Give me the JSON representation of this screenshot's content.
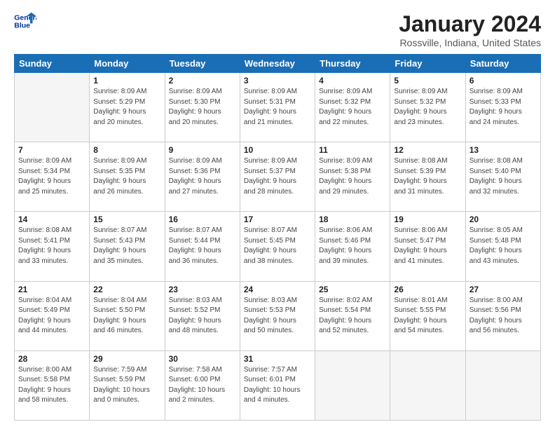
{
  "logo": {
    "line1": "General",
    "line2": "Blue"
  },
  "title": "January 2024",
  "subtitle": "Rossville, Indiana, United States",
  "weekdays": [
    "Sunday",
    "Monday",
    "Tuesday",
    "Wednesday",
    "Thursday",
    "Friday",
    "Saturday"
  ],
  "weeks": [
    [
      {
        "day": "",
        "info": ""
      },
      {
        "day": "1",
        "info": "Sunrise: 8:09 AM\nSunset: 5:29 PM\nDaylight: 9 hours\nand 20 minutes."
      },
      {
        "day": "2",
        "info": "Sunrise: 8:09 AM\nSunset: 5:30 PM\nDaylight: 9 hours\nand 20 minutes."
      },
      {
        "day": "3",
        "info": "Sunrise: 8:09 AM\nSunset: 5:31 PM\nDaylight: 9 hours\nand 21 minutes."
      },
      {
        "day": "4",
        "info": "Sunrise: 8:09 AM\nSunset: 5:32 PM\nDaylight: 9 hours\nand 22 minutes."
      },
      {
        "day": "5",
        "info": "Sunrise: 8:09 AM\nSunset: 5:32 PM\nDaylight: 9 hours\nand 23 minutes."
      },
      {
        "day": "6",
        "info": "Sunrise: 8:09 AM\nSunset: 5:33 PM\nDaylight: 9 hours\nand 24 minutes."
      }
    ],
    [
      {
        "day": "7",
        "info": "Sunrise: 8:09 AM\nSunset: 5:34 PM\nDaylight: 9 hours\nand 25 minutes."
      },
      {
        "day": "8",
        "info": "Sunrise: 8:09 AM\nSunset: 5:35 PM\nDaylight: 9 hours\nand 26 minutes."
      },
      {
        "day": "9",
        "info": "Sunrise: 8:09 AM\nSunset: 5:36 PM\nDaylight: 9 hours\nand 27 minutes."
      },
      {
        "day": "10",
        "info": "Sunrise: 8:09 AM\nSunset: 5:37 PM\nDaylight: 9 hours\nand 28 minutes."
      },
      {
        "day": "11",
        "info": "Sunrise: 8:09 AM\nSunset: 5:38 PM\nDaylight: 9 hours\nand 29 minutes."
      },
      {
        "day": "12",
        "info": "Sunrise: 8:08 AM\nSunset: 5:39 PM\nDaylight: 9 hours\nand 31 minutes."
      },
      {
        "day": "13",
        "info": "Sunrise: 8:08 AM\nSunset: 5:40 PM\nDaylight: 9 hours\nand 32 minutes."
      }
    ],
    [
      {
        "day": "14",
        "info": "Sunrise: 8:08 AM\nSunset: 5:41 PM\nDaylight: 9 hours\nand 33 minutes."
      },
      {
        "day": "15",
        "info": "Sunrise: 8:07 AM\nSunset: 5:43 PM\nDaylight: 9 hours\nand 35 minutes."
      },
      {
        "day": "16",
        "info": "Sunrise: 8:07 AM\nSunset: 5:44 PM\nDaylight: 9 hours\nand 36 minutes."
      },
      {
        "day": "17",
        "info": "Sunrise: 8:07 AM\nSunset: 5:45 PM\nDaylight: 9 hours\nand 38 minutes."
      },
      {
        "day": "18",
        "info": "Sunrise: 8:06 AM\nSunset: 5:46 PM\nDaylight: 9 hours\nand 39 minutes."
      },
      {
        "day": "19",
        "info": "Sunrise: 8:06 AM\nSunset: 5:47 PM\nDaylight: 9 hours\nand 41 minutes."
      },
      {
        "day": "20",
        "info": "Sunrise: 8:05 AM\nSunset: 5:48 PM\nDaylight: 9 hours\nand 43 minutes."
      }
    ],
    [
      {
        "day": "21",
        "info": "Sunrise: 8:04 AM\nSunset: 5:49 PM\nDaylight: 9 hours\nand 44 minutes."
      },
      {
        "day": "22",
        "info": "Sunrise: 8:04 AM\nSunset: 5:50 PM\nDaylight: 9 hours\nand 46 minutes."
      },
      {
        "day": "23",
        "info": "Sunrise: 8:03 AM\nSunset: 5:52 PM\nDaylight: 9 hours\nand 48 minutes."
      },
      {
        "day": "24",
        "info": "Sunrise: 8:03 AM\nSunset: 5:53 PM\nDaylight: 9 hours\nand 50 minutes."
      },
      {
        "day": "25",
        "info": "Sunrise: 8:02 AM\nSunset: 5:54 PM\nDaylight: 9 hours\nand 52 minutes."
      },
      {
        "day": "26",
        "info": "Sunrise: 8:01 AM\nSunset: 5:55 PM\nDaylight: 9 hours\nand 54 minutes."
      },
      {
        "day": "27",
        "info": "Sunrise: 8:00 AM\nSunset: 5:56 PM\nDaylight: 9 hours\nand 56 minutes."
      }
    ],
    [
      {
        "day": "28",
        "info": "Sunrise: 8:00 AM\nSunset: 5:58 PM\nDaylight: 9 hours\nand 58 minutes."
      },
      {
        "day": "29",
        "info": "Sunrise: 7:59 AM\nSunset: 5:59 PM\nDaylight: 10 hours\nand 0 minutes."
      },
      {
        "day": "30",
        "info": "Sunrise: 7:58 AM\nSunset: 6:00 PM\nDaylight: 10 hours\nand 2 minutes."
      },
      {
        "day": "31",
        "info": "Sunrise: 7:57 AM\nSunset: 6:01 PM\nDaylight: 10 hours\nand 4 minutes."
      },
      {
        "day": "",
        "info": ""
      },
      {
        "day": "",
        "info": ""
      },
      {
        "day": "",
        "info": ""
      }
    ]
  ]
}
